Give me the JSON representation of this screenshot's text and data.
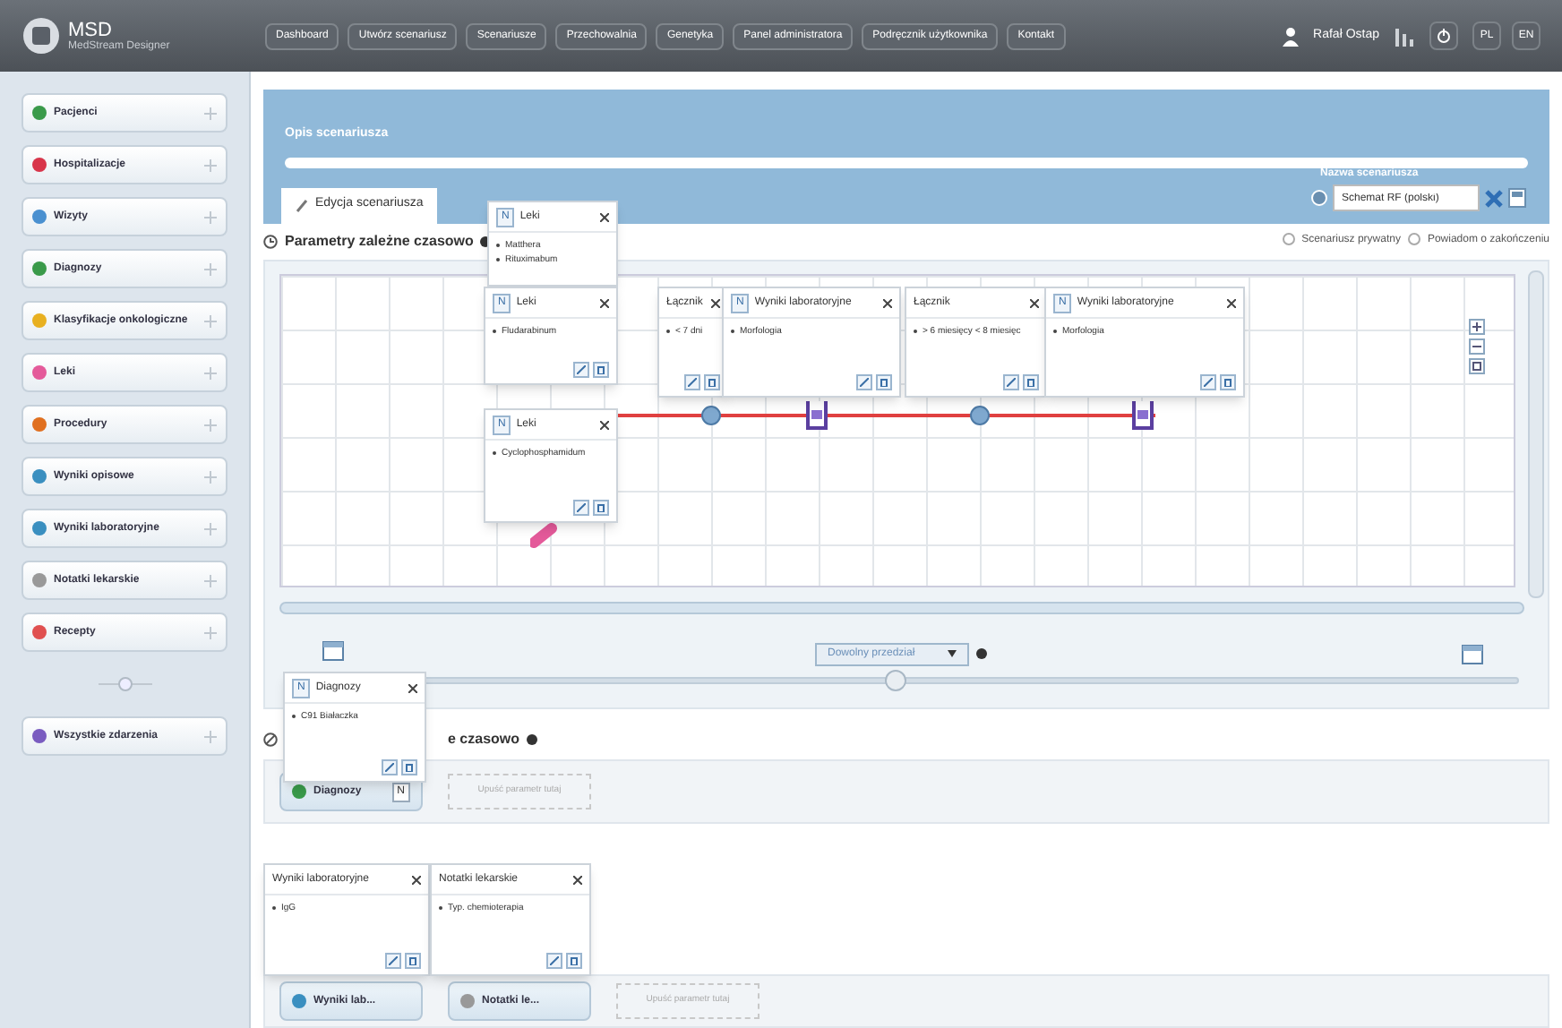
{
  "app": {
    "name": "MSD",
    "subtitle": "MedStream Designer"
  },
  "nav": [
    "Dashboard",
    "Utwórz scenariusz",
    "Scenariusze",
    "Przechowalnia",
    "Genetyka",
    "Panel administratora",
    "Podręcznik użytkownika",
    "Kontakt"
  ],
  "user": {
    "name": "Rafał Ostap",
    "languages": [
      "PL",
      "EN"
    ]
  },
  "sidebar": {
    "items": [
      "Pacjenci",
      "Hospitalizacje",
      "Wizyty",
      "Diagnozy",
      "Klasyfikacje onkologiczne",
      "Leki",
      "Procedury",
      "Wyniki opisowe",
      "Wyniki laboratoryjne",
      "Notatki lekarskie",
      "Recepty"
    ],
    "all_events": "Wszystkie zdarzenia"
  },
  "header": {
    "description_label": "Opis scenariusza",
    "tab": "Edycja scenariusza",
    "name_label": "Nazwa scenariusza",
    "name_value": "Schemat RF (polski)"
  },
  "time_dependent": {
    "title": "Parametry zależne czasowo",
    "options": [
      {
        "label": "Scenariusz prywatny",
        "checked": false
      },
      {
        "label": "Powiadom o zakończeniu",
        "checked": false
      }
    ],
    "range": "Dowolny przedział",
    "slider": {
      "level": 0.47
    }
  },
  "popups": [
    {
      "badge": "N",
      "title": "Leki",
      "items": [
        "Matthera",
        "Rituximabum"
      ]
    },
    {
      "badge": "N",
      "title": "Leki",
      "items": [
        "Fludarabinum"
      ]
    },
    {
      "title": "Łącznik",
      "items": [
        "< 7 dni"
      ]
    },
    {
      "badge": "N",
      "title": "Wyniki laboratoryjne",
      "items": [
        "Morfologia"
      ]
    },
    {
      "title": "Łącznik",
      "items": [
        "> 6 miesięcy < 8 miesięc"
      ]
    },
    {
      "badge": "N",
      "title": "Wyniki laboratoryjne",
      "items": [
        "Morfologia"
      ]
    },
    {
      "badge": "N",
      "title": "Leki",
      "items": [
        "Cyclophosphamidum"
      ]
    },
    {
      "badge": "N",
      "title": "Diagnozy",
      "items": [
        "C91 Białaczka"
      ]
    },
    {
      "title": "Wyniki laboratoryjne",
      "items": [
        "IgG"
      ]
    },
    {
      "title": "Notatki lekarskie",
      "items": [
        "Typ. chemioterapia"
      ]
    }
  ],
  "time_independent": {
    "title_visible": "e czasowo",
    "rows": [
      {
        "chips": [
          {
            "label": "Diagnozy",
            "badge": "N"
          }
        ],
        "drop": "Upuść parametr tutaj"
      },
      {
        "chips": [
          {
            "label": "Wyniki lab..."
          },
          {
            "label": "Notatki le..."
          }
        ],
        "drop": "Upuść parametr tutaj"
      }
    ]
  }
}
